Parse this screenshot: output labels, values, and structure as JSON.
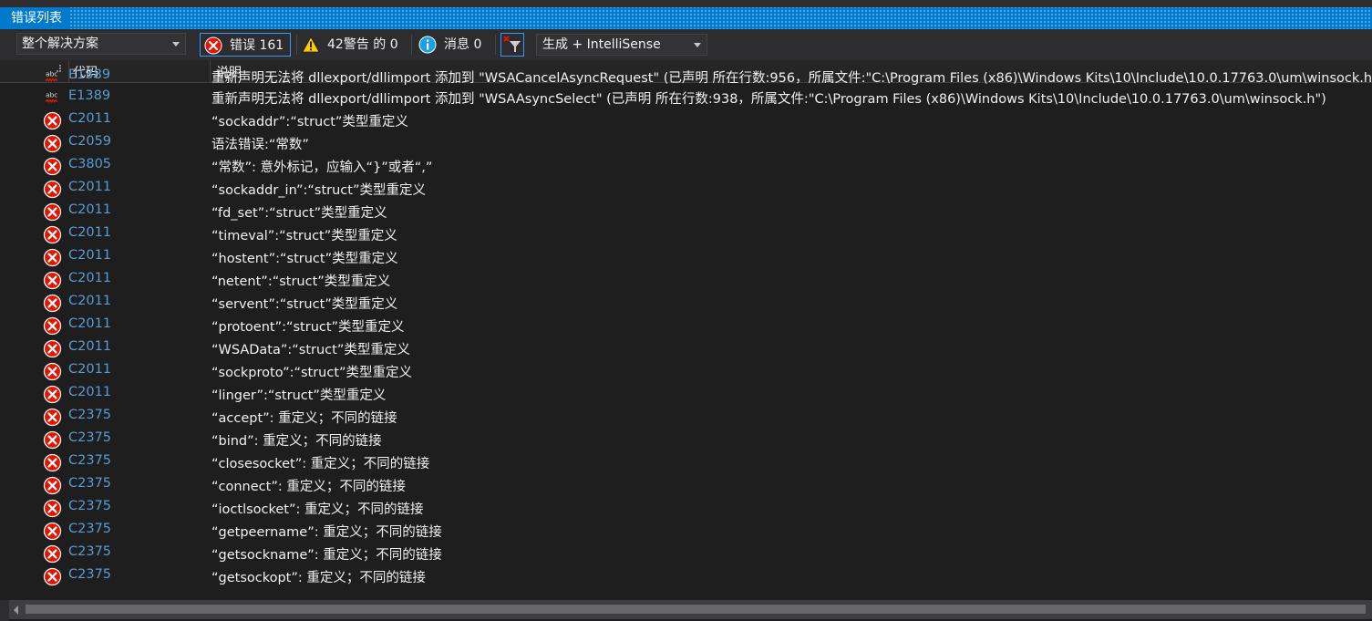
{
  "window": {
    "title": "错误列表"
  },
  "toolbar": {
    "scope": "整个解决方案",
    "errors_label": "错误 161",
    "warnings_label": "42警告 的 0",
    "messages_label": "消息 0",
    "build_source": "生成 + IntelliSense"
  },
  "columns": {
    "code": "代码",
    "description": "说明"
  },
  "colors": {
    "accent": "#007acc",
    "error": "#e51400",
    "warning": "#ffcc00",
    "info": "#1ba1e2",
    "code_link": "#569cd6"
  },
  "rows": [
    {
      "icon": "intellisense-error-icon",
      "code": "E1389",
      "description": "重新声明无法将 dllexport/dllimport 添加到 \"WSACancelAsyncRequest\" (已声明 所在行数:956，所属文件:\"C:\\Program Files (x86)\\Windows Kits\\10\\Include\\10.0.17763.0\\um\\winsock.h\")"
    },
    {
      "icon": "intellisense-error-icon",
      "code": "E1389",
      "description": "重新声明无法将 dllexport/dllimport 添加到 \"WSAAsyncSelect\" (已声明 所在行数:938，所属文件:\"C:\\Program Files (x86)\\Windows Kits\\10\\Include\\10.0.17763.0\\um\\winsock.h\")"
    },
    {
      "icon": "error-icon",
      "code": "C2011",
      "description": "“sockaddr”:“struct”类型重定义"
    },
    {
      "icon": "error-icon",
      "code": "C2059",
      "description": "语法错误:“常数”"
    },
    {
      "icon": "error-icon",
      "code": "C3805",
      "description": "“常数”: 意外标记，应输入“}”或者“,”"
    },
    {
      "icon": "error-icon",
      "code": "C2011",
      "description": "“sockaddr_in”:“struct”类型重定义"
    },
    {
      "icon": "error-icon",
      "code": "C2011",
      "description": "“fd_set”:“struct”类型重定义"
    },
    {
      "icon": "error-icon",
      "code": "C2011",
      "description": "“timeval”:“struct”类型重定义"
    },
    {
      "icon": "error-icon",
      "code": "C2011",
      "description": "“hostent”:“struct”类型重定义"
    },
    {
      "icon": "error-icon",
      "code": "C2011",
      "description": "“netent”:“struct”类型重定义"
    },
    {
      "icon": "error-icon",
      "code": "C2011",
      "description": "“servent”:“struct”类型重定义"
    },
    {
      "icon": "error-icon",
      "code": "C2011",
      "description": "“protoent”:“struct”类型重定义"
    },
    {
      "icon": "error-icon",
      "code": "C2011",
      "description": "“WSAData”:“struct”类型重定义"
    },
    {
      "icon": "error-icon",
      "code": "C2011",
      "description": "“sockproto”:“struct”类型重定义"
    },
    {
      "icon": "error-icon",
      "code": "C2011",
      "description": "“linger”:“struct”类型重定义"
    },
    {
      "icon": "error-icon",
      "code": "C2375",
      "description": "“accept”: 重定义；不同的链接"
    },
    {
      "icon": "error-icon",
      "code": "C2375",
      "description": "“bind”: 重定义；不同的链接"
    },
    {
      "icon": "error-icon",
      "code": "C2375",
      "description": "“closesocket”: 重定义；不同的链接"
    },
    {
      "icon": "error-icon",
      "code": "C2375",
      "description": "“connect”: 重定义；不同的链接"
    },
    {
      "icon": "error-icon",
      "code": "C2375",
      "description": "“ioctlsocket”: 重定义；不同的链接"
    },
    {
      "icon": "error-icon",
      "code": "C2375",
      "description": "“getpeername”: 重定义；不同的链接"
    },
    {
      "icon": "error-icon",
      "code": "C2375",
      "description": "“getsockname”: 重定义；不同的链接"
    },
    {
      "icon": "error-icon",
      "code": "C2375",
      "description": "“getsockopt”: 重定义；不同的链接"
    }
  ]
}
